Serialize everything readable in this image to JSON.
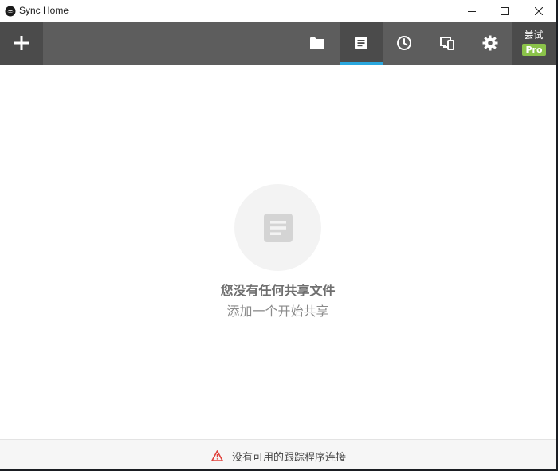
{
  "window": {
    "title": "Sync Home"
  },
  "toolbar": {
    "add_icon": "plus-icon",
    "tabs": [
      {
        "icon": "folder-icon",
        "active": false
      },
      {
        "icon": "document-icon",
        "active": true
      },
      {
        "icon": "clock-icon",
        "active": false
      },
      {
        "icon": "devices-icon",
        "active": false
      },
      {
        "icon": "gear-icon",
        "active": false
      }
    ],
    "trial": {
      "label": "尝试",
      "badge": "Pro"
    }
  },
  "main": {
    "empty_icon": "document-icon",
    "title": "您没有任何共享文件",
    "subtitle": "添加一个开始共享"
  },
  "status": {
    "icon": "warning-icon",
    "text": "没有可用的跟踪程序连接"
  },
  "colors": {
    "toolbar_bg": "#5d5d5d",
    "toolbar_dark": "#4b4b4b",
    "active_indicator": "#2aa7de",
    "pro_badge": "#8bc34a",
    "warning": "#e0403a"
  }
}
